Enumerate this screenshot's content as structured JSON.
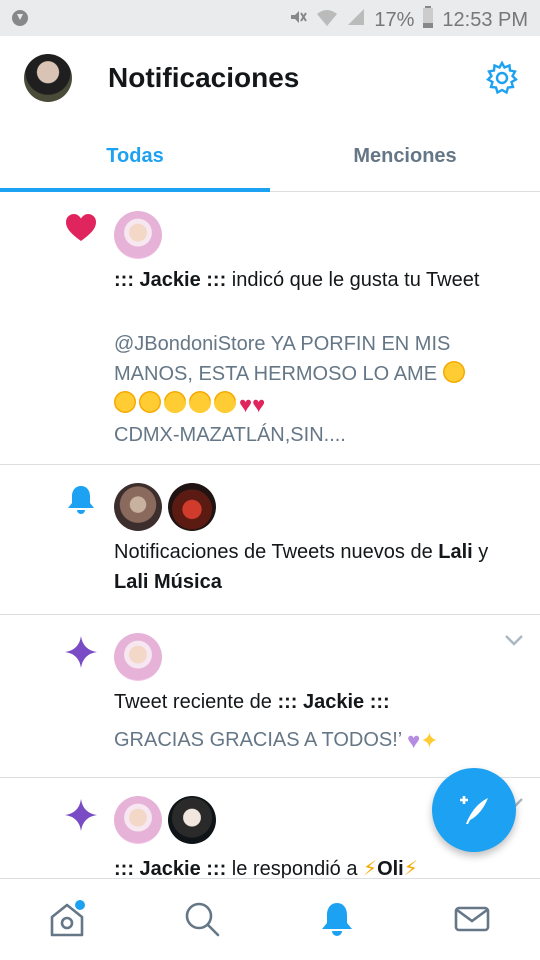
{
  "status_bar": {
    "battery": "17%",
    "time": "12:53 PM"
  },
  "header": {
    "title": "Notificaciones",
    "settings_icon": "gear-icon"
  },
  "tabs": [
    {
      "label": "Todas",
      "active": true
    },
    {
      "label": "Menciones",
      "active": false
    }
  ],
  "notifications": [
    {
      "type": "like",
      "icon": "heart-icon",
      "actor": "::: Jackie :::",
      "action": " indicó que le gusta tu Tweet",
      "tweet_text": "@JBondoniStore YA PORFIN EN MIS MANOS, ESTA HERMOSO LO AME",
      "tweet_tail": "CDMX-MAZATLÁN,SIN...."
    },
    {
      "type": "tweet-notifications",
      "icon": "bell-icon",
      "prefix": "Notificaciones de Tweets nuevos de ",
      "user1": "Lali",
      "joiner": " y ",
      "user2": "Lali Música"
    },
    {
      "type": "recent-tweet",
      "icon": "sparkle-icon",
      "prefix": "Tweet reciente de ",
      "actor": "::: Jackie :::",
      "tweet_text": "GRACIAS GRACIAS A TODOS!’"
    },
    {
      "type": "reply",
      "icon": "sparkle-icon",
      "actor": "::: Jackie :::",
      "action": " le respondió a ",
      "target": "Oli"
    }
  ],
  "fab": {
    "icon": "compose-tweet-icon"
  },
  "bottom_nav": [
    {
      "name": "home",
      "icon": "home-icon",
      "active": false
    },
    {
      "name": "search",
      "icon": "search-icon",
      "active": false
    },
    {
      "name": "notifications",
      "icon": "bell-icon",
      "active": true
    },
    {
      "name": "messages",
      "icon": "mail-icon",
      "active": false
    }
  ],
  "colors": {
    "accent": "#1da1f2",
    "like": "#e0245e",
    "sparkle": "#794bc4",
    "secondary_text": "#657786"
  }
}
